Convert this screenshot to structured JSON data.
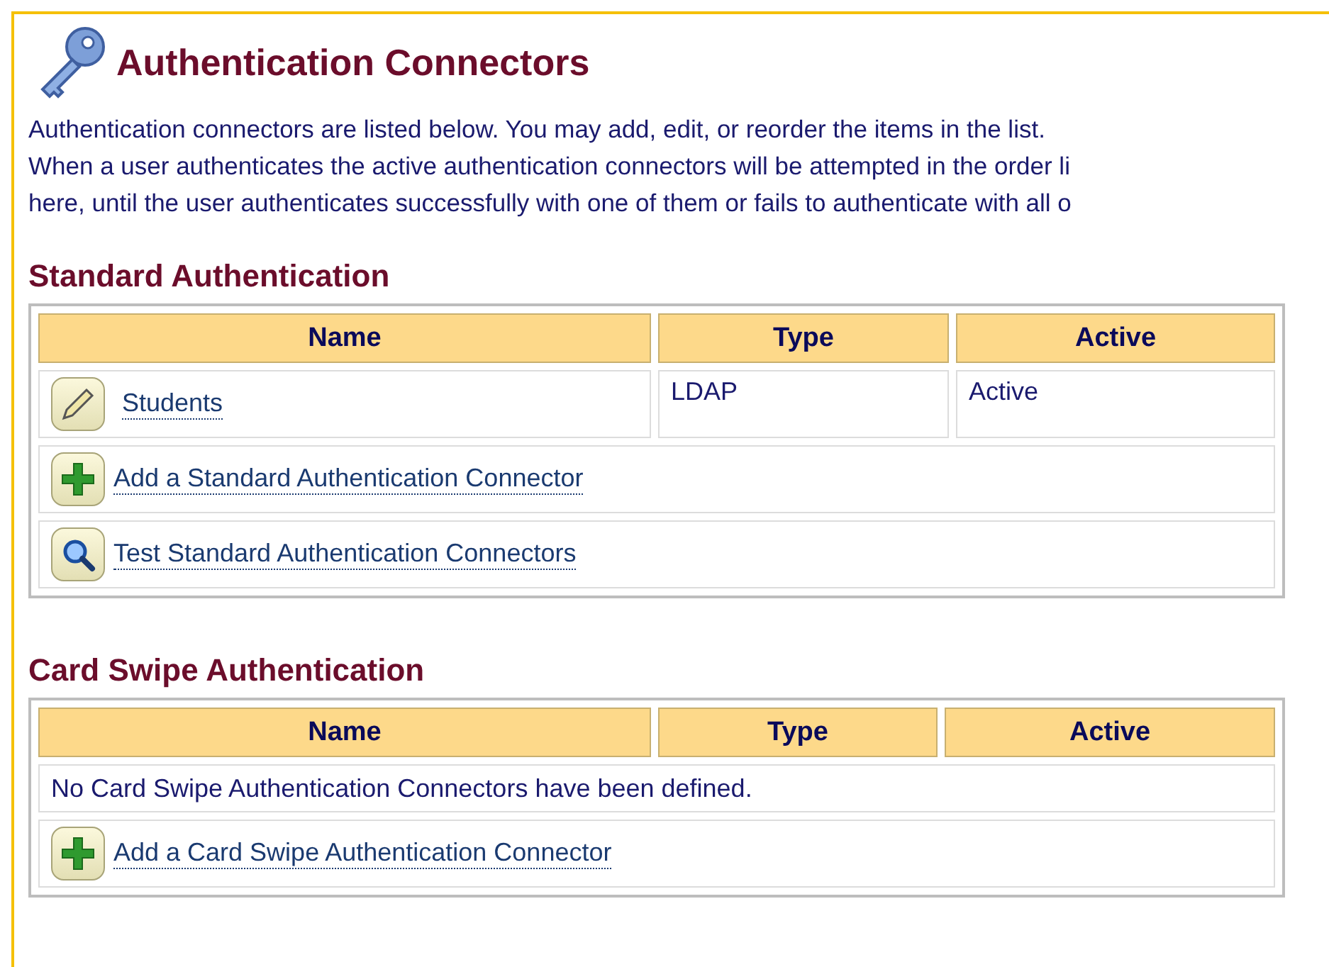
{
  "page": {
    "title": "Authentication Connectors",
    "description": [
      "Authentication connectors are listed below. You may add, edit, or reorder the items in the list.",
      "When a user authenticates the active authentication connectors will be attempted in the order li",
      "here, until the user authenticates successfully with one of them or fails to authenticate with all o"
    ]
  },
  "sections": [
    {
      "title": "Standard Authentication",
      "columns": [
        "Name",
        "Type",
        "Active"
      ],
      "rows": [
        {
          "name": "Students",
          "type": "LDAP",
          "active": "Active"
        }
      ],
      "actions": [
        {
          "kind": "add",
          "label": "Add a Standard Authentication Connector"
        },
        {
          "kind": "test",
          "label": "Test Standard Authentication Connectors"
        }
      ]
    },
    {
      "title": "Card Swipe Authentication",
      "columns": [
        "Name",
        "Type",
        "Active"
      ],
      "message": "No Card Swipe Authentication Connectors have been defined.",
      "actions": [
        {
          "kind": "add",
          "label": "Add a Card Swipe Authentication Connector"
        }
      ]
    }
  ]
}
